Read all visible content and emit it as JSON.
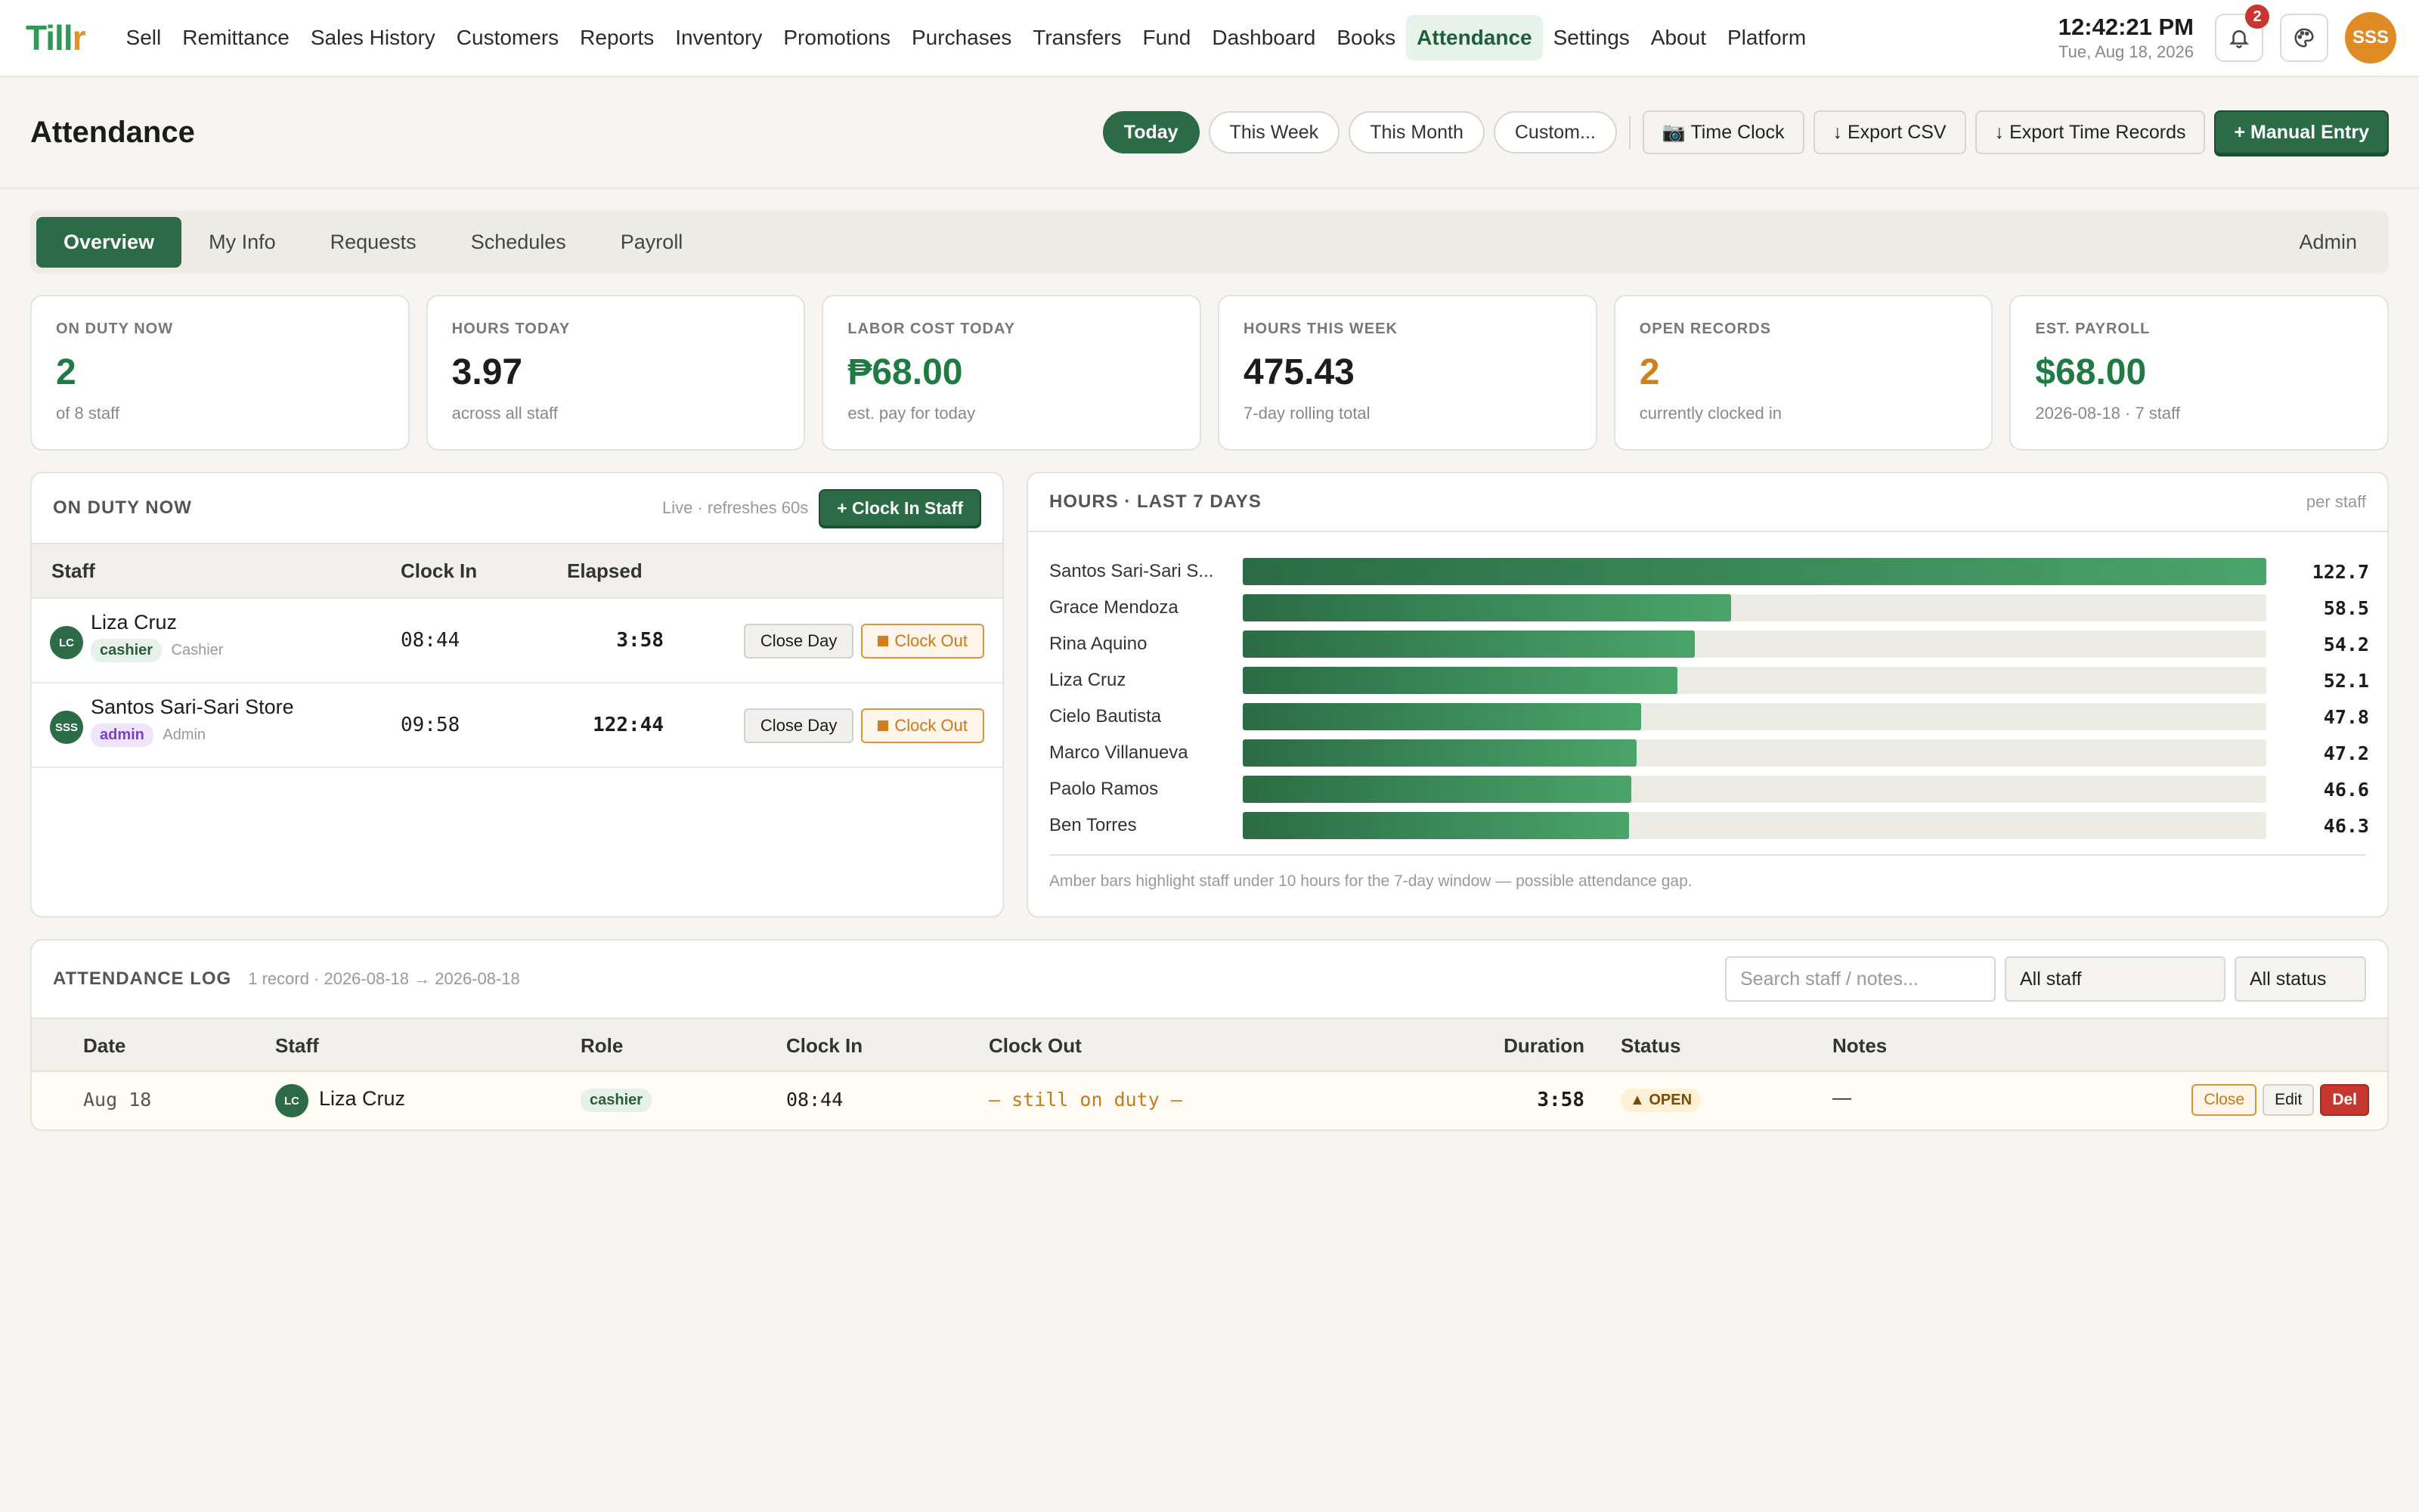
{
  "app": {
    "logo_main": "Till",
    "logo_accent": "r"
  },
  "nav": [
    "Sell",
    "Remittance",
    "Sales History",
    "Customers",
    "Reports",
    "Inventory",
    "Promotions",
    "Purchases",
    "Transfers",
    "Fund",
    "Dashboard",
    "Books",
    "Attendance",
    "Settings",
    "About",
    "Platform"
  ],
  "active_nav": "Attendance",
  "clock": {
    "time": "12:42:21 PM",
    "date": "Tue, Aug 18, 2026"
  },
  "notifications": {
    "count": "2",
    "icon": "bell-icon"
  },
  "user": {
    "initials": "SSS"
  },
  "page": {
    "title": "Attendance",
    "ranges": [
      "Today",
      "This Week",
      "This Month",
      "Custom..."
    ],
    "time_clock": "📷 Time Clock",
    "export_csv": "↓ Export CSV",
    "export_time_records": "↓ Export Time Records",
    "manual_entry": "+ Manual Entry"
  },
  "tabs": [
    "Overview",
    "My Info",
    "Requests",
    "Schedules",
    "Payroll"
  ],
  "tab_role": "Admin",
  "stats": [
    {
      "label": "ON DUTY NOW",
      "value": "2",
      "sub": "of 8 staff",
      "tone": "green"
    },
    {
      "label": "HOURS TODAY",
      "value": "3.97",
      "sub": "across all staff",
      "tone": "dark"
    },
    {
      "label": "LABOR COST TODAY",
      "value": "₱68.00",
      "sub": "est. pay for today",
      "tone": "green"
    },
    {
      "label": "HOURS THIS WEEK",
      "value": "475.43",
      "sub": "7-day rolling total",
      "tone": "dark"
    },
    {
      "label": "OPEN RECORDS",
      "value": "2",
      "sub": "currently clocked in",
      "tone": "amber"
    },
    {
      "label": "EST. PAYROLL",
      "value": "$68.00",
      "sub": "2026-08-18 · 7 staff",
      "tone": "green"
    }
  ],
  "on_duty": {
    "title": "ON DUTY NOW",
    "live": "Live · refreshes 60s",
    "clock_in_button": "+ Clock In Staff",
    "columns": [
      "Staff",
      "Clock In",
      "Elapsed"
    ],
    "rows": [
      {
        "initials": "LC",
        "name": "Liza Cruz",
        "role_tag": "cashier",
        "role_label": "Cashier",
        "clock_in": "08:44",
        "elapsed": "3:58",
        "close_day": "Close Day",
        "clock_out": "Clock Out"
      },
      {
        "initials": "SSS",
        "name": "Santos Sari-Sari Store",
        "role_tag": "admin",
        "role_label": "Admin",
        "clock_in": "09:58",
        "elapsed": "122:44",
        "close_day": "Close Day",
        "clock_out": "Clock Out"
      }
    ]
  },
  "hours": {
    "title": "HOURS · LAST 7 DAYS",
    "per": "per staff",
    "note": "Amber bars highlight staff under 10 hours for the 7-day window — possible attendance gap."
  },
  "chart_data": {
    "type": "bar",
    "orientation": "horizontal",
    "categories": [
      "Santos Sari-Sari S...",
      "Grace Mendoza",
      "Rina Aquino",
      "Liza Cruz",
      "Cielo Bautista",
      "Marco Villanueva",
      "Paolo Ramos",
      "Ben Torres"
    ],
    "values": [
      122.7,
      58.5,
      54.2,
      52.1,
      47.8,
      47.2,
      46.6,
      46.3
    ],
    "value_labels": [
      "122.7",
      "58.5",
      "54.2",
      "52.1",
      "47.8",
      "47.2",
      "46.6",
      "46.3"
    ],
    "xlim": [
      0,
      122.7
    ],
    "colors": {
      "bar": "#2b6b45",
      "track": "#edebe6"
    }
  },
  "log": {
    "title": "ATTENDANCE LOG",
    "meta": "1 record · 2026-08-18 → 2026-08-18",
    "search_placeholder": "Search staff / notes...",
    "staff_filter": "All staff",
    "status_filter": "All status",
    "columns": [
      "Date",
      "Staff",
      "Role",
      "Clock In",
      "Clock Out",
      "Duration",
      "Status",
      "Notes"
    ],
    "rows": [
      {
        "date": "Aug 18",
        "initials": "LC",
        "staff": "Liza Cruz",
        "role": "cashier",
        "clock_in": "08:44",
        "clock_out": "— still on duty —",
        "duration": "3:58",
        "status": "▲ OPEN",
        "notes": "—",
        "close": "Close",
        "edit": "Edit",
        "del": "Del"
      }
    ]
  }
}
